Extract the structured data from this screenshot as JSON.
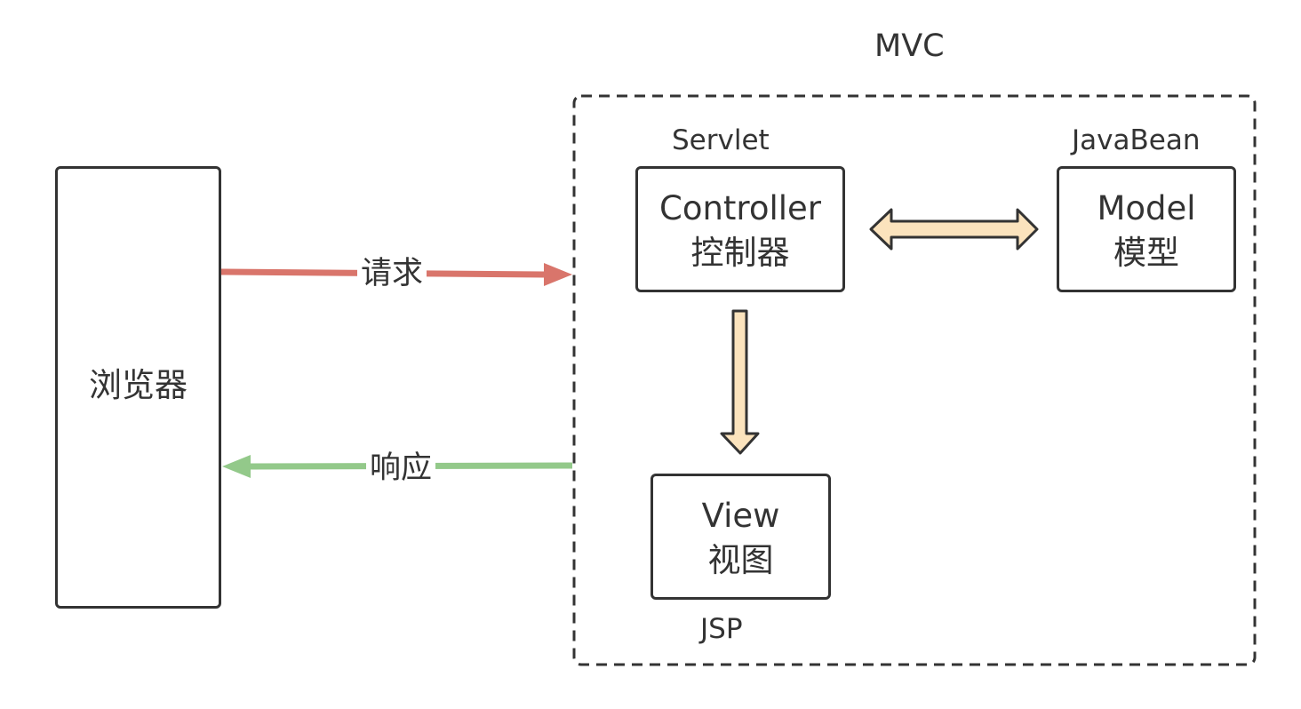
{
  "browser": {
    "label": "浏览器"
  },
  "mvc": {
    "title": "MVC",
    "controller": {
      "tech": "Servlet",
      "name": "Controller",
      "name_cn": "控制器"
    },
    "model": {
      "tech": "JavaBean",
      "name": "Model",
      "name_cn": "模型"
    },
    "view": {
      "tech": "JSP",
      "name": "View",
      "name_cn": "视图"
    }
  },
  "edges": {
    "request": {
      "label": "请求",
      "color": "#d9756b"
    },
    "response": {
      "label": "响应",
      "color": "#93c98a"
    },
    "bidirectional_fill": "#fbe3bd",
    "down_fill": "#fbe3bd"
  }
}
